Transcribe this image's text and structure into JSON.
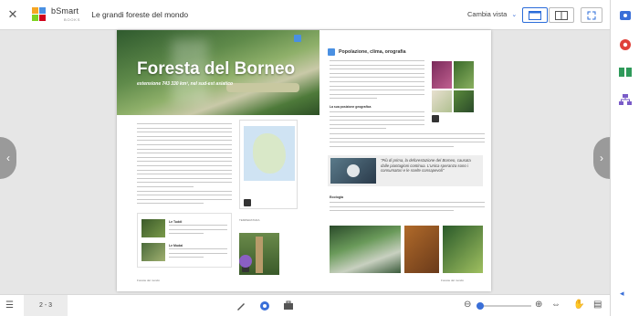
{
  "app": {
    "title": "Le grandi foreste del mondo",
    "logo_text": "bSmart",
    "logo_sub": "BOOKS",
    "view_label": "Cambia vista",
    "page_indicator": "2 - 3",
    "brand_color": "#2b6cd9"
  },
  "book": {
    "left": {
      "title": "Foresta del Borneo",
      "subtitle": "estensione 743 330 km², nel sud-est asiatico",
      "caption_orangutan": "Le Tuddi",
      "caption_bridge": "Le Mudai",
      "map_caption": "TEMPERATURA",
      "footer": "Foreste del mondo"
    },
    "right": {
      "heading": "Popolazione, clima, orografia",
      "subheading": "La sua posizione geografica",
      "quote": "\"Più di prima, la deforestazione del Borneo, causata dalle piantagioni continua. L'unica speranza sono i consumatori e le scelte consapevoli\"",
      "ecology_heading": "Ecologia",
      "footer": "Foreste del mondo"
    }
  },
  "icons": {
    "close": "close-icon",
    "single_page": "single-page-view-icon",
    "double_page": "double-page-view-icon",
    "fullscreen": "fullscreen-icon"
  }
}
